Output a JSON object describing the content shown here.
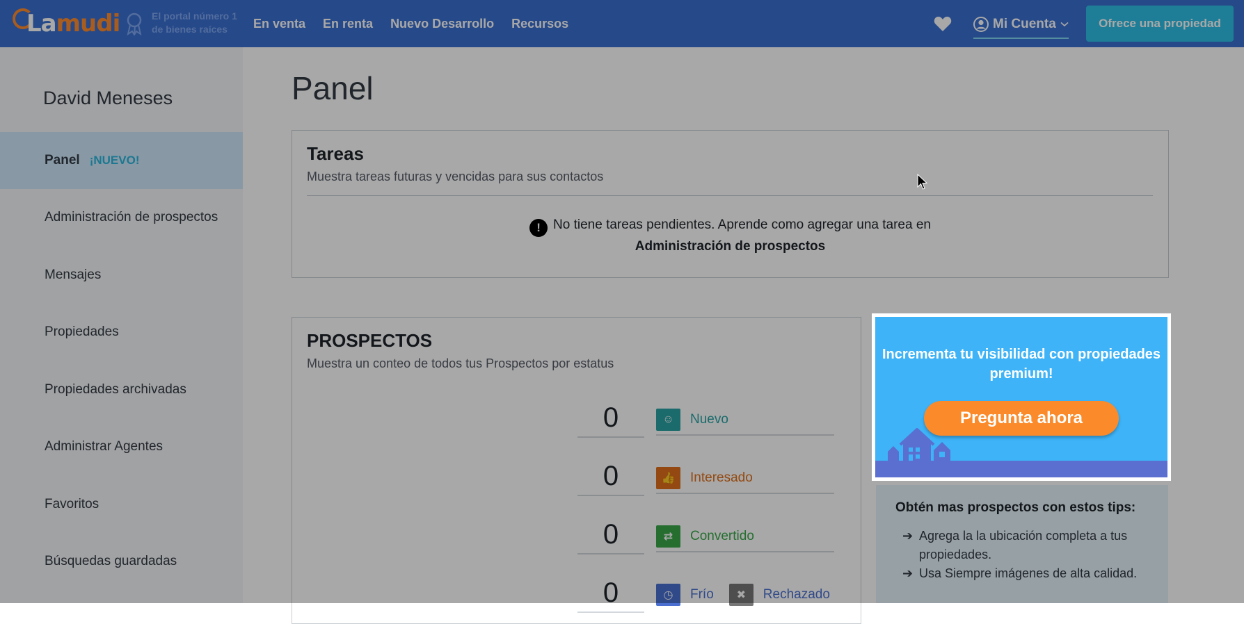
{
  "navbar": {
    "logo_text_a": "La",
    "logo_text_b": "mudi",
    "tagline_line1": "El portal número 1",
    "tagline_line2": "de bienes raíces",
    "links": [
      {
        "label": "En venta"
      },
      {
        "label": "En renta"
      },
      {
        "label": "Nuevo Desarrollo"
      },
      {
        "label": "Recursos"
      }
    ],
    "account_label": "Mi Cuenta",
    "offer_button": "Ofrece una propiedad",
    "icons": [
      "award-icon",
      "heart-icon",
      "user-icon",
      "chevron-down-icon"
    ]
  },
  "sidebar": {
    "user_name": "David Meneses",
    "items": [
      {
        "label": "Panel",
        "badge": "¡NUEVO!",
        "active": true
      },
      {
        "label": "Administración de prospectos"
      },
      {
        "label": "Mensajes"
      },
      {
        "label": "Propiedades"
      },
      {
        "label": "Propiedades archivadas"
      },
      {
        "label": "Administrar Agentes"
      },
      {
        "label": "Favoritos"
      },
      {
        "label": "Búsquedas guardadas"
      }
    ]
  },
  "main": {
    "page_title": "Panel",
    "tasks": {
      "title": "Tareas",
      "subtitle": "Muestra tareas futuras y vencidas para sus contactos",
      "notice_text": "No tiene tareas pendientes. Aprende como agregar una tarea en",
      "notice_link": "Administración de prospectos"
    },
    "prospects": {
      "title": "PROSPECTOS",
      "subtitle": "Muestra un conteo de todos tus Prospectos por estatus",
      "statuses": [
        {
          "count": "0",
          "label": "Nuevo",
          "color": "#2aa3a5",
          "icon": "smile-icon"
        },
        {
          "count": "0",
          "label": "Interesado",
          "color": "#e0701a",
          "icon": "thumb-icon"
        },
        {
          "count": "0",
          "label": "Convertido",
          "color": "#3aa84a",
          "icon": "handshake-icon"
        },
        {
          "count": "0",
          "label": "Frío",
          "color": "#4a6fd0",
          "icon": "clock-icon"
        },
        {
          "label": "Rechazado",
          "color": "#777777",
          "icon": "close-icon"
        }
      ]
    }
  },
  "promo": {
    "headline": "Incrementa tu visibilidad con propiedades premium!",
    "button": "Pregunta ahora"
  },
  "tips": {
    "title": "Obtén mas prospectos con estos tips:",
    "items": [
      "Agrega la la ubicación completa a tus propiedades.",
      "Usa Siempre imágenes de alta calidad."
    ]
  },
  "colors": {
    "navbar": "#3b6fd1",
    "accent_orange": "#fb8b2a",
    "offer_button": "#2ec0e6",
    "promo_bg": "#3eb3f7"
  }
}
